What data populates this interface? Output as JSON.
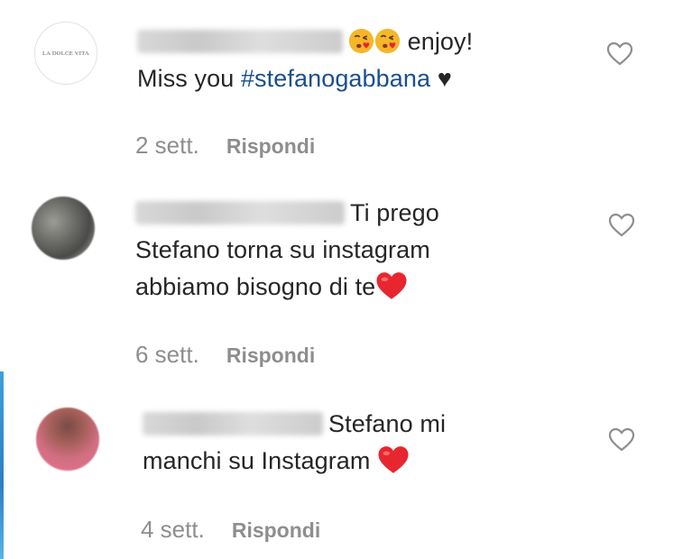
{
  "comments": [
    {
      "avatar_text": "LA DOLCE VITA",
      "line1": " enjoy!",
      "line2_prefix": "Miss you ",
      "hashtag": "#stefanogabbana",
      "line2_suffix": " ♥",
      "time": "2 sett.",
      "reply": "Rispondi"
    },
    {
      "line1": "Ti prego",
      "line2": "Stefano torna su instagram",
      "line3": "abbiamo bisogno di te",
      "time": "6 sett.",
      "reply": "Rispondi"
    },
    {
      "line1": "Stefano mi",
      "line2": "manchi su Instagram ",
      "time": "4 sett.",
      "reply": "Rispondi"
    }
  ],
  "icons": {
    "like": "heart-outline-icon",
    "kiss": "face-blowing-kiss-emoji",
    "red_heart": "red-heart-emoji"
  },
  "colors": {
    "text": "#262626",
    "muted": "#8e8e8e",
    "hashtag": "#1a4f8e",
    "red_heart": "#e8262f"
  }
}
